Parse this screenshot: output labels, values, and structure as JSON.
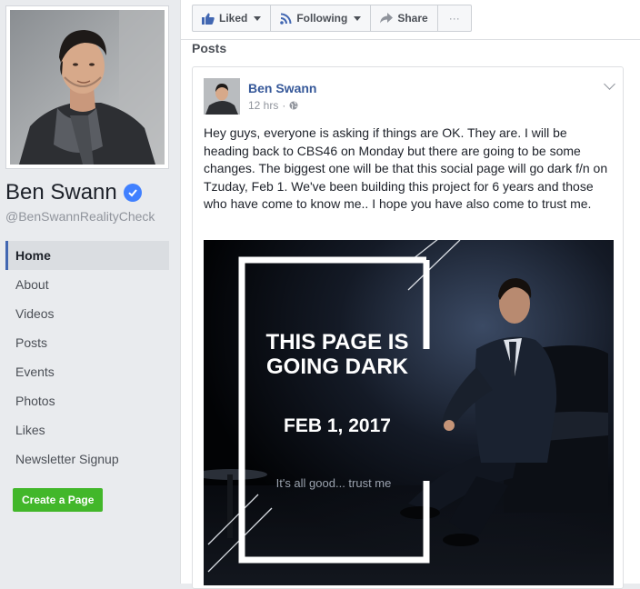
{
  "page": {
    "name": "Ben Swann",
    "handle": "@BenSwannRealityCheck"
  },
  "nav": {
    "items": [
      {
        "label": "Home"
      },
      {
        "label": "About"
      },
      {
        "label": "Videos"
      },
      {
        "label": "Posts"
      },
      {
        "label": "Events"
      },
      {
        "label": "Photos"
      },
      {
        "label": "Likes"
      },
      {
        "label": "Newsletter Signup"
      }
    ],
    "active": "Home",
    "create_page_label": "Create a Page"
  },
  "actions": {
    "liked_label": "Liked",
    "following_label": "Following",
    "share_label": "Share",
    "more_label": "···"
  },
  "posts": {
    "heading": "Posts",
    "post": {
      "author": "Ben Swann",
      "time": "12 hrs",
      "separator": "·",
      "text": "Hey guys, everyone is asking if things are OK. They are. I will be heading back to CBS46 on Monday but there are going to be some changes. The biggest one will be that this social page will go dark f/n on Tzuday, Feb 1. We've been building this project for 6 years and those who have come to know me.. I hope you have also come to trust me.",
      "image": {
        "headline_line1": "THIS PAGE IS",
        "headline_line2": "GOING DARK",
        "date": "FEB 1, 2017",
        "tagline": "It's all good... trust me"
      }
    }
  },
  "colors": {
    "link": "#365899",
    "accent": "#4267b2",
    "verified": "#4080ff",
    "create_page": "#42b72a"
  }
}
